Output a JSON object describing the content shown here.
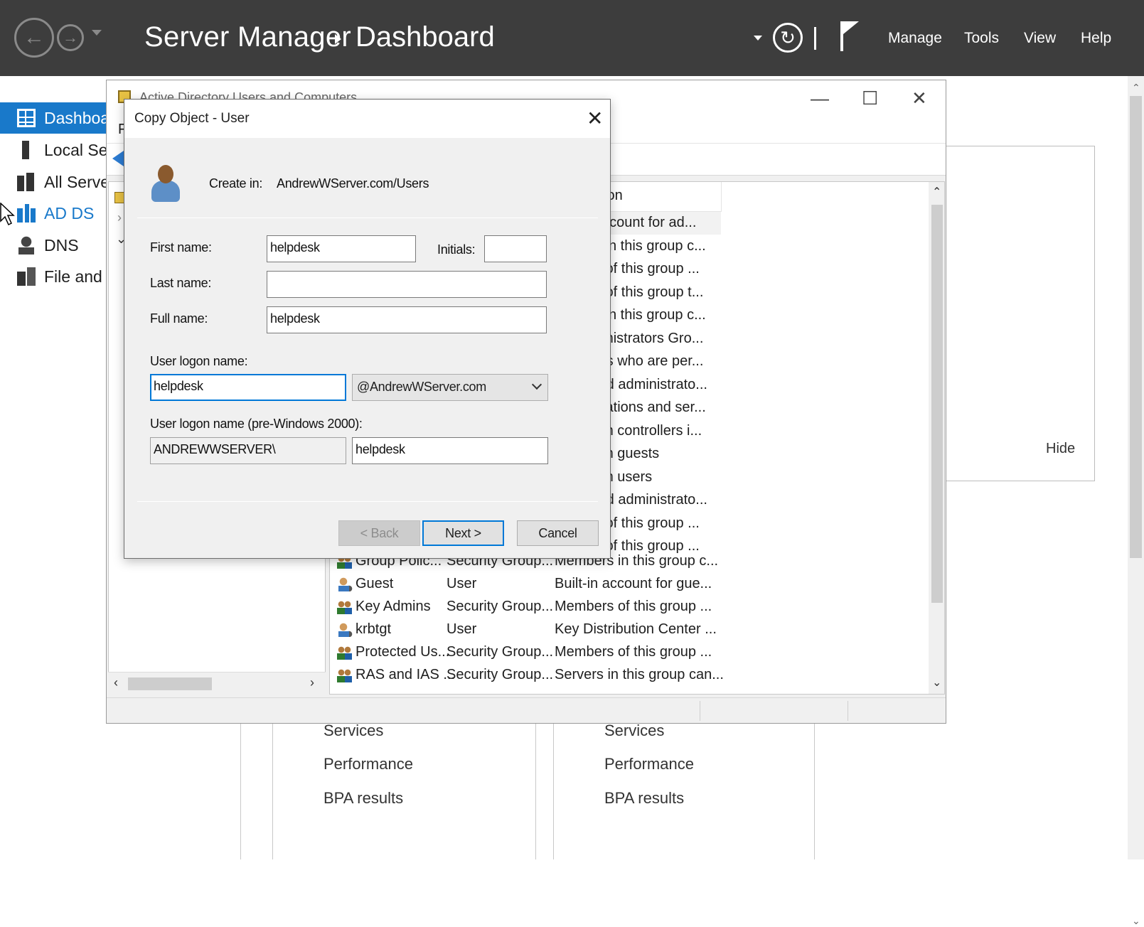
{
  "header": {
    "app_title": "Server Manager",
    "page_title": "Dashboard",
    "menu": [
      "Manage",
      "Tools",
      "View",
      "Help"
    ]
  },
  "sidebar": {
    "items": [
      {
        "label": "Dashboard",
        "icon": "dashboard-icon"
      },
      {
        "label": "Local Server",
        "icon": "local-server-icon"
      },
      {
        "label": "All Servers",
        "icon": "all-servers-icon"
      },
      {
        "label": "AD DS",
        "icon": "ad-ds-icon"
      },
      {
        "label": "DNS",
        "icon": "dns-icon"
      },
      {
        "label": "File and Storage Services",
        "icon": "file-storage-icon"
      }
    ]
  },
  "dashboard": {
    "hide_label": "Hide",
    "tile_left": [
      "Services",
      "Performance",
      "BPA results"
    ],
    "tile_right": [
      "Services",
      "Performance",
      "BPA results"
    ]
  },
  "aduc": {
    "title": "Active Directory Users and Computers",
    "menu_first": "F",
    "column_description": "ion",
    "partial_rows": [
      "account for ad...",
      "s in this group c...",
      "s of this group ...",
      "s of this group t...",
      "s in this group c...",
      "ninistrators Gro...",
      "nts who are per...",
      "ted administrato...",
      "stations and ser...",
      "ain controllers i...",
      "ain guests",
      "ain users",
      "ted administrato...",
      "s of this group ...",
      "s of this group ..."
    ],
    "rows": [
      {
        "name": "Group Polic...",
        "type": "Security Group...",
        "description": "Members in this group c...",
        "kind": "group"
      },
      {
        "name": "Guest",
        "type": "User",
        "description": "Built-in account for gue...",
        "kind": "user"
      },
      {
        "name": "Key Admins",
        "type": "Security Group...",
        "description": "Members of this group ...",
        "kind": "group"
      },
      {
        "name": "krbtgt",
        "type": "User",
        "description": "Key Distribution Center ...",
        "kind": "user"
      },
      {
        "name": "Protected Us...",
        "type": "Security Group...",
        "description": "Members of this group ...",
        "kind": "group"
      },
      {
        "name": "RAS and IAS ...",
        "type": "Security Group...",
        "description": "Servers in this group can...",
        "kind": "group"
      }
    ]
  },
  "dialog": {
    "title": "Copy Object - User",
    "create_in_label": "Create in:",
    "create_in_value": "AndrewWServer.com/Users",
    "first_name_label": "First name:",
    "first_name_value": "helpdesk",
    "initials_label": "Initials:",
    "initials_value": "",
    "last_name_label": "Last name:",
    "last_name_value": "",
    "full_name_label": "Full name:",
    "full_name_value": "helpdesk",
    "logon_label": "User logon name:",
    "logon_value": "helpdesk",
    "domain_value": "@AndrewWServer.com",
    "prewin_label": "User logon name (pre-Windows 2000):",
    "prewin_domain": "ANDREWWSERVER\\",
    "prewin_value": "helpdesk",
    "back_label": "< Back",
    "next_label": "Next >",
    "cancel_label": "Cancel"
  }
}
